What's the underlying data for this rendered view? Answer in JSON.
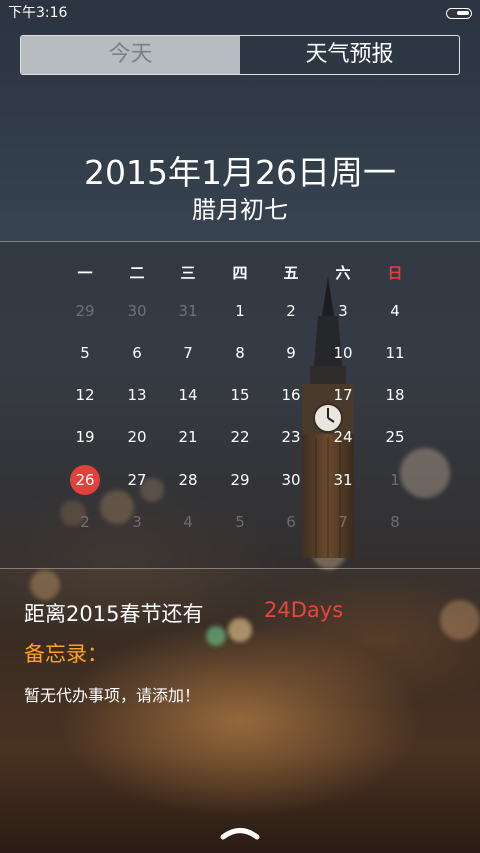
{
  "status_bar": {
    "time": "下午3:16",
    "battery_level": 0.9
  },
  "tabs": [
    {
      "label": "今天",
      "active": true
    },
    {
      "label": "天气预报",
      "active": false
    }
  ],
  "date": {
    "solar": "2015年1月26日周一",
    "lunar": "腊月初七"
  },
  "calendar": {
    "weekdays": [
      "一",
      "二",
      "三",
      "四",
      "五",
      "六",
      "日"
    ],
    "weeks": [
      [
        "29",
        "30",
        "31",
        "1",
        "2",
        "3",
        "4"
      ],
      [
        "5",
        "6",
        "7",
        "8",
        "9",
        "10",
        "11"
      ],
      [
        "12",
        "13",
        "14",
        "15",
        "16",
        "17",
        "18"
      ],
      [
        "19",
        "20",
        "21",
        "22",
        "23",
        "24",
        "25"
      ],
      [
        "26",
        "27",
        "28",
        "29",
        "30",
        "31",
        "1"
      ],
      [
        "2",
        "3",
        "4",
        "5",
        "6",
        "7",
        "8"
      ]
    ],
    "selected_day": "26",
    "accent_color": "#e0423b"
  },
  "countdown": {
    "label": "距离2015春节还有",
    "value": "24Days",
    "color": "#e8453d"
  },
  "memo": {
    "title": "备忘录：",
    "text": "暂无代办事项，请添加！",
    "title_color": "#ffa21a"
  },
  "icons": {
    "handle": "chevron-up-icon",
    "battery": "battery-icon"
  }
}
